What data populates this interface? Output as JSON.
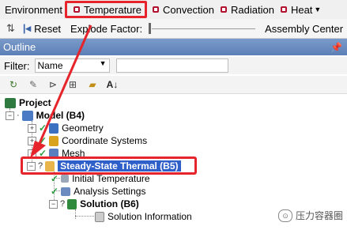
{
  "env_toolbar": {
    "label": "Environment",
    "items": [
      {
        "label": "Temperature"
      },
      {
        "label": "Convection"
      },
      {
        "label": "Radiation"
      },
      {
        "label": "Heat"
      }
    ]
  },
  "toolbar2": {
    "reset_label": "Reset",
    "explode_label": "Explode Factor:",
    "assembly_label": "Assembly Center"
  },
  "outline": {
    "title": "Outline",
    "filter_label": "Filter:",
    "filter_value": "Name"
  },
  "tree": {
    "project": "Project",
    "model": "Model (B4)",
    "geometry": "Geometry",
    "coords": "Coordinate Systems",
    "mesh": "Mesh",
    "analysis": "Steady-State Thermal (B5)",
    "initial_temp": "Initial Temperature",
    "analysis_settings": "Analysis Settings",
    "solution": "Solution (B6)",
    "solution_info": "Solution Information"
  },
  "watermark": "压力容器圈",
  "colors": {
    "highlight_red": "#e5242b",
    "selection_blue": "#2f5fc9",
    "header_blue": "#6a8cc0"
  }
}
